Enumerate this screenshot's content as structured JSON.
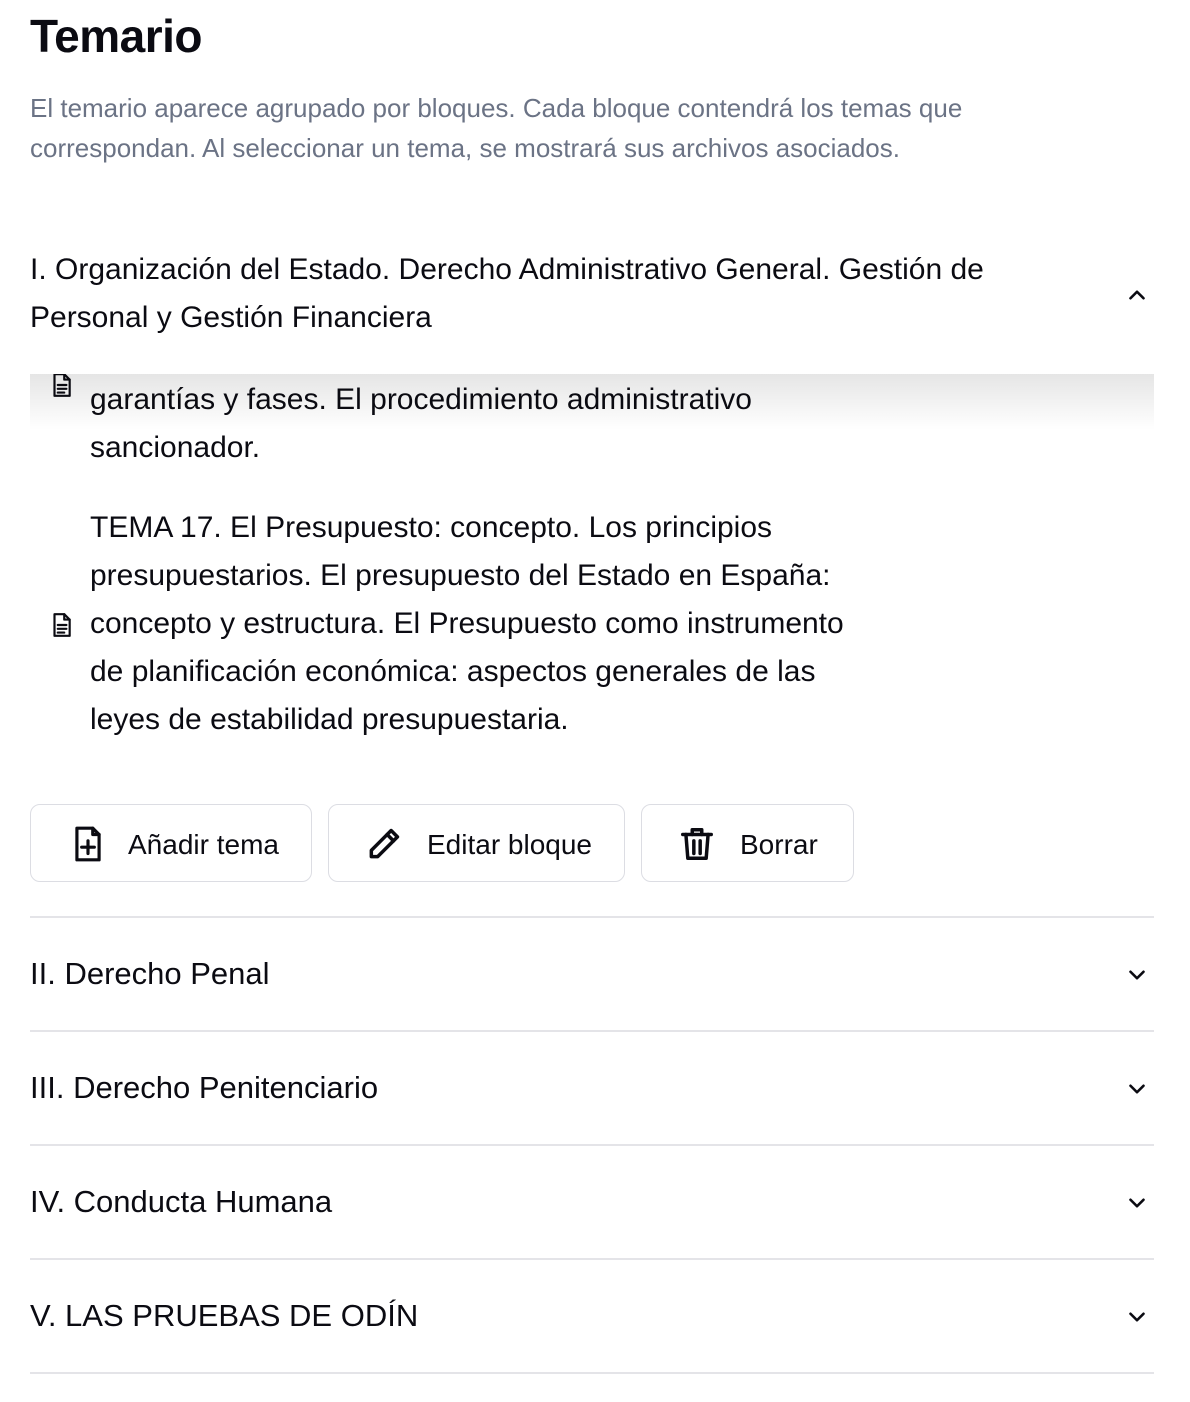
{
  "page": {
    "title": "Temario",
    "description": "El temario aparece agrupado por bloques. Cada bloque contendrá los temas que correspondan. Al seleccionar un tema, se mostrará sus archivos asociados."
  },
  "blocks": [
    {
      "title": "I. Organización del Estado. Derecho Administrativo General. Gestión de Personal y Gestión Financiera",
      "expanded": true,
      "topics": [
        {
          "text": "garantías y fases. El procedimiento administrativo sancionador."
        },
        {
          "text": "TEMA 17. El Presupuesto: concepto. Los principios presupuestarios. El presupuesto del Estado en España: concepto y estructura. El Presupuesto como instrumento de planificación económica: aspectos generales de las leyes de estabilidad presupuestaria."
        }
      ],
      "actions": {
        "add_topic": "Añadir tema",
        "edit_block": "Editar bloque",
        "delete": "Borrar"
      }
    },
    {
      "title": "II. Derecho Penal",
      "expanded": false
    },
    {
      "title": "III. Derecho Penitenciario",
      "expanded": false
    },
    {
      "title": "IV. Conducta Humana",
      "expanded": false
    },
    {
      "title": "V. LAS PRUEBAS DE ODÍN",
      "expanded": false
    }
  ],
  "icons": {
    "collapse": "chevron-up-icon",
    "expand": "chevron-down-icon",
    "topic": "document-icon",
    "add": "file-plus-icon",
    "edit": "pencil-icon",
    "delete": "trash-icon"
  },
  "colors": {
    "text": "#0b0b12",
    "muted": "#6b7385",
    "border": "#dcdde3",
    "divider": "#e4e4e8"
  }
}
